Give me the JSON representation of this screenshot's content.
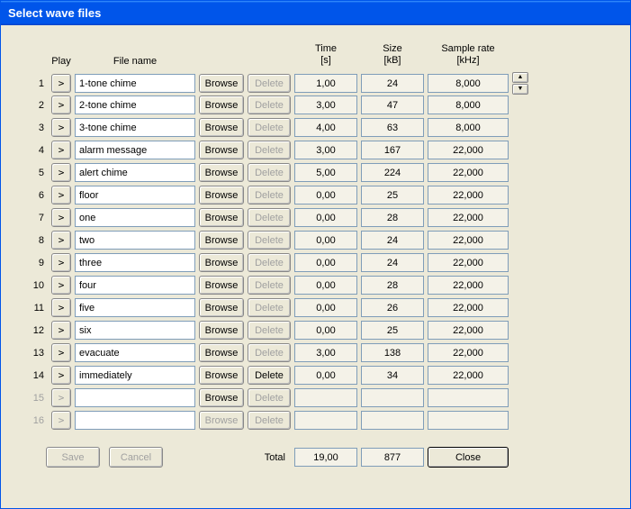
{
  "window": {
    "title": "Select wave files"
  },
  "headers": {
    "play": "Play",
    "filename": "File name",
    "time": "Time\n[s]",
    "size": "Size\n[kB]",
    "sample": "Sample rate\n[kHz]"
  },
  "glyphs": {
    "play": ">",
    "up": "▲",
    "down": "▼"
  },
  "buttons": {
    "browse": "Browse",
    "delete": "Delete",
    "save": "Save",
    "cancel": "Cancel",
    "close": "Close"
  },
  "footer": {
    "total_label": "Total",
    "total_time": "19,00",
    "total_size": "877"
  },
  "rows": [
    {
      "n": "1",
      "name": "1-tone chime",
      "time": "1,00",
      "size": "24",
      "rate": "8,000",
      "play": true,
      "browse": true,
      "del": false
    },
    {
      "n": "2",
      "name": "2-tone chime",
      "time": "3,00",
      "size": "47",
      "rate": "8,000",
      "play": true,
      "browse": true,
      "del": false
    },
    {
      "n": "3",
      "name": "3-tone chime",
      "time": "4,00",
      "size": "63",
      "rate": "8,000",
      "play": true,
      "browse": true,
      "del": false
    },
    {
      "n": "4",
      "name": "alarm message",
      "time": "3,00",
      "size": "167",
      "rate": "22,000",
      "play": true,
      "browse": true,
      "del": false
    },
    {
      "n": "5",
      "name": "alert chime",
      "time": "5,00",
      "size": "224",
      "rate": "22,000",
      "play": true,
      "browse": true,
      "del": false
    },
    {
      "n": "6",
      "name": "floor",
      "time": "0,00",
      "size": "25",
      "rate": "22,000",
      "play": true,
      "browse": true,
      "del": false
    },
    {
      "n": "7",
      "name": "one",
      "time": "0,00",
      "size": "28",
      "rate": "22,000",
      "play": true,
      "browse": true,
      "del": false
    },
    {
      "n": "8",
      "name": "two",
      "time": "0,00",
      "size": "24",
      "rate": "22,000",
      "play": true,
      "browse": true,
      "del": false
    },
    {
      "n": "9",
      "name": "three",
      "time": "0,00",
      "size": "24",
      "rate": "22,000",
      "play": true,
      "browse": true,
      "del": false
    },
    {
      "n": "10",
      "name": "four",
      "time": "0,00",
      "size": "28",
      "rate": "22,000",
      "play": true,
      "browse": true,
      "del": false
    },
    {
      "n": "11",
      "name": "five",
      "time": "0,00",
      "size": "26",
      "rate": "22,000",
      "play": true,
      "browse": true,
      "del": false
    },
    {
      "n": "12",
      "name": "six",
      "time": "0,00",
      "size": "25",
      "rate": "22,000",
      "play": true,
      "browse": true,
      "del": false
    },
    {
      "n": "13",
      "name": "evacuate",
      "time": "3,00",
      "size": "138",
      "rate": "22,000",
      "play": true,
      "browse": true,
      "del": false
    },
    {
      "n": "14",
      "name": "immediately",
      "time": "0,00",
      "size": "34",
      "rate": "22,000",
      "play": true,
      "browse": true,
      "del": true
    },
    {
      "n": "15",
      "name": "",
      "time": "",
      "size": "",
      "rate": "",
      "play": false,
      "browse": true,
      "del": false,
      "dim": true
    },
    {
      "n": "16",
      "name": "",
      "time": "",
      "size": "",
      "rate": "",
      "play": false,
      "browse": false,
      "del": false,
      "dim": true
    }
  ]
}
